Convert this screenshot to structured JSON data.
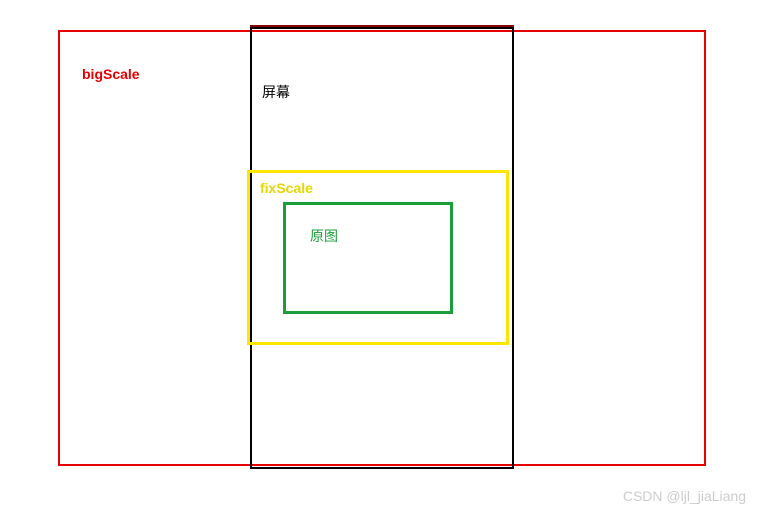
{
  "diagram": {
    "bigScale": {
      "label": "bigScale",
      "color": "#e60000"
    },
    "screen": {
      "label": "屏幕",
      "color": "#000000"
    },
    "fixScale": {
      "label": "fixScale",
      "color": "#ffe600"
    },
    "original": {
      "label": "原图",
      "color": "#1a9e3a"
    }
  },
  "watermark": "CSDN @ljl_jiaLiang"
}
